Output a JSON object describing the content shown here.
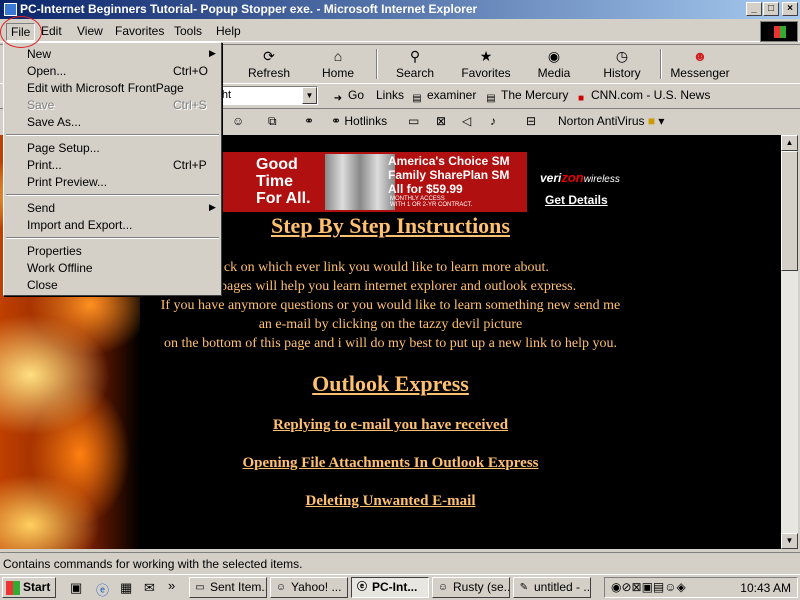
{
  "window": {
    "title": "PC-Internet Beginners Tutorial- Popup Stopper exe. - Microsoft Internet Explorer",
    "min": "_",
    "max": "□",
    "close": "×"
  },
  "menubar": [
    "File",
    "Edit",
    "View",
    "Favorites",
    "Tools",
    "Help"
  ],
  "toolbar": {
    "refresh": "Refresh",
    "home": "Home",
    "search": "Search",
    "favorites": "Favorites",
    "media": "Media",
    "history": "History",
    "messenger": "Messenger"
  },
  "address": {
    "value": "e/janny/index.ht",
    "go": "Go",
    "links": "Links"
  },
  "links": [
    "examiner",
    "The Mercury",
    "CNN.com - U.S. News"
  ],
  "toolbar2": {
    "hotlinks": "Hotlinks",
    "norton": "Norton AntiVirus"
  },
  "file_menu": {
    "new": "New",
    "open": "Open...",
    "open_sc": "Ctrl+O",
    "edit_fp": "Edit with Microsoft FrontPage",
    "save": "Save",
    "save_sc": "Ctrl+S",
    "save_as": "Save As...",
    "page_setup": "Page Setup...",
    "print": "Print...",
    "print_sc": "Ctrl+P",
    "print_preview": "Print Preview...",
    "send": "Send",
    "import_export": "Import and Export...",
    "properties": "Properties",
    "work_offline": "Work Offline",
    "close": "Close"
  },
  "banner": {
    "good": "Good",
    "time": "Time",
    "forall": "For All.",
    "choice1": "America's Choice SM",
    "choice2": "Family SharePlan SM",
    "price": "All for $59.99",
    "monthly": "MONTHLY ACCESS",
    "contract": "WITH 1 OR 2-YR CONTRACT.",
    "verizon": "veri",
    "zon": "zon",
    "wireless": "wireless",
    "details": "Get Details"
  },
  "page": {
    "heading": "Step By Step Instructions",
    "l1": "ick on which ever link you would like to learn more about.",
    "l2": "pages will help you  learn internet explorer  and outlook express.",
    "l3": "If you have anymore questions or you would like to learn something new send me",
    "l4": "an e-mail by clicking on the tazzy devil picture",
    "l5": "on the bottom of this page and i will do my best to put up a new link to help you.",
    "oe": "Outlook Express",
    "link1": "Replying to e-mail you have received",
    "link2": "Opening File Attachments In Outlook Express",
    "link3": "Deleting Unwanted E-mail"
  },
  "status": "Contains commands for working with the selected items.",
  "taskbar": {
    "start": "Start",
    "tasks": [
      "Sent Item...",
      "Yahoo! ...",
      "PC-Int...",
      "Rusty (se...",
      "untitled - ..."
    ],
    "clock": "10:43 AM"
  }
}
